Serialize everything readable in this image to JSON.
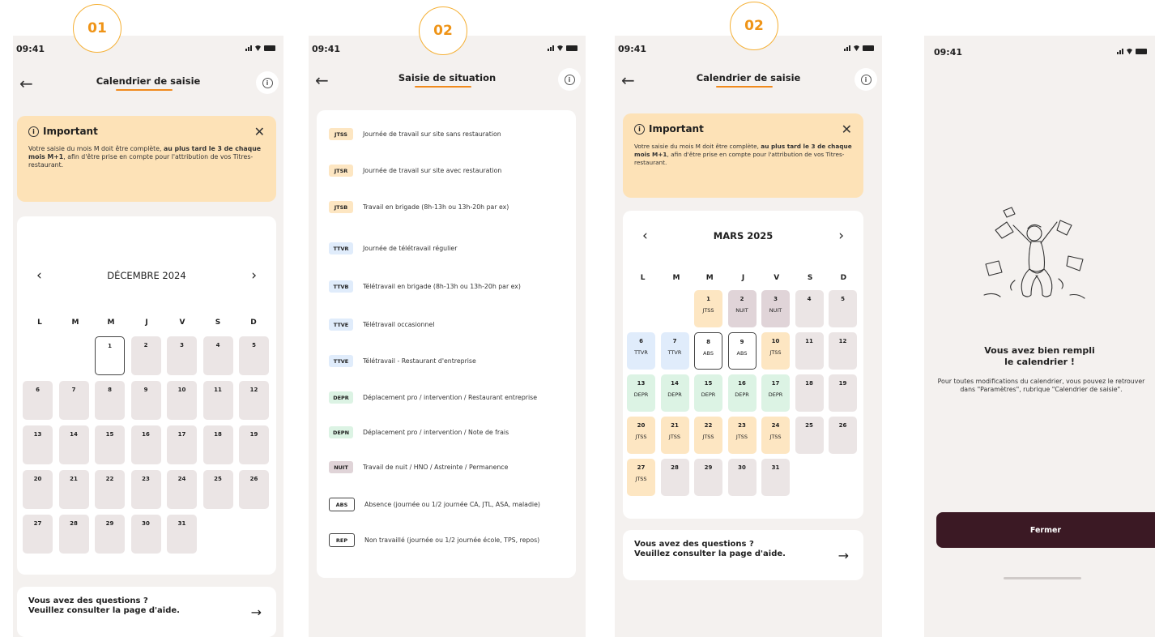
{
  "steps": {
    "s1": "01",
    "s2": "02",
    "s3": "02"
  },
  "status_time": "09:41",
  "screen1": {
    "title": "Calendrier de saisie",
    "alert": {
      "title": "Important",
      "text_a": "Votre saisie du mois M doit être complète, ",
      "text_b": "au plus tard le 3 de chaque mois M+1",
      "text_c": ", afin d'être prise en compte pour l'attribution de vos Titres-restaurant."
    },
    "month": "DÉCEMBRE 2024",
    "weekdays": [
      "L",
      "M",
      "M",
      "J",
      "V",
      "S",
      "D"
    ],
    "help": {
      "line1": "Vous avez des questions ?",
      "line2": "Veuillez consulter la page d'aide."
    }
  },
  "screen2": {
    "title": "Saisie de situation",
    "situations": [
      {
        "code": "JTSS",
        "label": "Journée de travail sur site sans restauration",
        "color": "#fde6c2"
      },
      {
        "code": "JTSR",
        "label": "Journée de travail sur site avec restauration",
        "color": "#fde6c2"
      },
      {
        "code": "JTSB",
        "label": "Travail en brigade (8h-13h ou 13h-20h par ex)",
        "color": "#fde6c2"
      },
      {
        "code": "TTVR",
        "label": "Journée de télétravail régulier",
        "color": "#e0ecfb"
      },
      {
        "code": "TTVB",
        "label": "Télétravail en brigade (8h-13h ou 13h-20h par ex)",
        "color": "#e0ecfb"
      },
      {
        "code": "TTVE",
        "label": "Télétravail occasionnel",
        "color": "#e0ecfb"
      },
      {
        "code": "TTVE",
        "label": "Télétravail - Restaurant d'entreprise",
        "color": "#e0ecfb"
      },
      {
        "code": "DEPR",
        "label": "Déplacement pro / intervention / Restaurant entreprise",
        "color": "#dcf3e4"
      },
      {
        "code": "DEPN",
        "label": "Déplacement pro / intervention / Note de frais",
        "color": "#dcf3e4"
      },
      {
        "code": "NUIT",
        "label": "Travail de nuit / HNO / Astreinte / Permanence",
        "color": "#e0d4d8"
      },
      {
        "code": "ABS",
        "label": "Absence (journée ou 1/2 journée CA, JTL, ASA, maladie)",
        "color": "#ffffff"
      },
      {
        "code": "REP",
        "label": "Non travaillé (journée ou 1/2 journée école, TPS, repos)",
        "color": "#ffffff"
      }
    ]
  },
  "screen3": {
    "title": "Calendrier de saisie",
    "month": "MARS 2025"
  },
  "screen4": {
    "title_line1": "Vous avez bien rempli",
    "title_line2": "le calendrier !",
    "text": "Pour toutes modifications du calendrier, vous pouvez le retrouver dans \"Paramètres\", rubrique \"Calendrier de saisie\".",
    "close_label": "Fermer"
  },
  "december_days": [
    {
      "d": "",
      "t": "empty"
    },
    {
      "d": "",
      "t": "empty"
    },
    {
      "d": "1",
      "t": "today"
    },
    {
      "d": "2"
    },
    {
      "d": "3"
    },
    {
      "d": "4"
    },
    {
      "d": "5"
    },
    {
      "d": "6"
    },
    {
      "d": "7"
    },
    {
      "d": "8"
    },
    {
      "d": "9"
    },
    {
      "d": "10"
    },
    {
      "d": "11"
    },
    {
      "d": "12"
    },
    {
      "d": "13"
    },
    {
      "d": "14"
    },
    {
      "d": "15"
    },
    {
      "d": "16"
    },
    {
      "d": "17"
    },
    {
      "d": "18"
    },
    {
      "d": "19"
    },
    {
      "d": "20"
    },
    {
      "d": "21"
    },
    {
      "d": "22"
    },
    {
      "d": "23"
    },
    {
      "d": "24"
    },
    {
      "d": "25"
    },
    {
      "d": "26"
    },
    {
      "d": "27"
    },
    {
      "d": "28"
    },
    {
      "d": "29"
    },
    {
      "d": "30"
    },
    {
      "d": "31"
    }
  ],
  "march_days": [
    {
      "d": "",
      "t": "empty"
    },
    {
      "d": "",
      "t": "empty"
    },
    {
      "d": "1",
      "c": "JTSS",
      "t": "jtss"
    },
    {
      "d": "2",
      "c": "NUIT",
      "t": "nuit"
    },
    {
      "d": "3",
      "c": "NUIT",
      "t": "nuit"
    },
    {
      "d": "4"
    },
    {
      "d": "5"
    },
    {
      "d": "6",
      "c": "TTVR",
      "t": "ttvr"
    },
    {
      "d": "7",
      "c": "TTVR",
      "t": "ttvr"
    },
    {
      "d": "8",
      "c": "ABS",
      "t": "abs"
    },
    {
      "d": "9",
      "c": "ABS",
      "t": "abs"
    },
    {
      "d": "10",
      "c": "JTSS",
      "t": "jtss"
    },
    {
      "d": "11"
    },
    {
      "d": "12"
    },
    {
      "d": "13",
      "c": "DEPR",
      "t": "depr"
    },
    {
      "d": "14",
      "c": "DEPR",
      "t": "depr"
    },
    {
      "d": "15",
      "c": "DEPR",
      "t": "depr"
    },
    {
      "d": "16",
      "c": "DEPR",
      "t": "depr"
    },
    {
      "d": "17",
      "c": "DEPR",
      "t": "depr"
    },
    {
      "d": "18"
    },
    {
      "d": "19"
    },
    {
      "d": "20",
      "c": "JTSS",
      "t": "jtss"
    },
    {
      "d": "21",
      "c": "JTSS",
      "t": "jtss"
    },
    {
      "d": "22",
      "c": "JTSS",
      "t": "jtss"
    },
    {
      "d": "23",
      "c": "JTSS",
      "t": "jtss"
    },
    {
      "d": "24",
      "c": "JTSS",
      "t": "jtss"
    },
    {
      "d": "25"
    },
    {
      "d": "26"
    },
    {
      "d": "27",
      "c": "JTSS",
      "t": "jtss"
    },
    {
      "d": "28"
    },
    {
      "d": "29"
    },
    {
      "d": "30"
    },
    {
      "d": "31"
    }
  ]
}
